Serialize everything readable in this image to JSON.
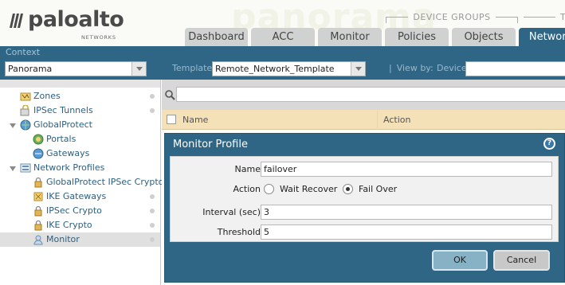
{
  "brand": {
    "name": "paloalto",
    "sub": "NETWORKS",
    "watermark": "panorama"
  },
  "header": {
    "group_label": "DEVICE GROUPS",
    "group_label_2": "T",
    "tabs": [
      {
        "label": "Dashboard",
        "active": false
      },
      {
        "label": "ACC",
        "active": false
      },
      {
        "label": "Monitor",
        "active": false
      },
      {
        "label": "Policies",
        "active": false
      },
      {
        "label": "Objects",
        "active": false
      },
      {
        "label": "Network",
        "active": true
      }
    ]
  },
  "context": {
    "label": "Context",
    "value": "Panorama",
    "template_label": "Template",
    "template_value": "Remote_Network_Template",
    "view_by_sep": "|",
    "view_by_label": "View by:",
    "device_label": "Device"
  },
  "sidebar": {
    "items": [
      {
        "label": "Zones",
        "icon": "zones-icon"
      },
      {
        "label": "IPSec Tunnels",
        "icon": "ipsec-tunnels-icon"
      },
      {
        "label": "GlobalProtect",
        "icon": "globalprotect-icon"
      },
      {
        "label": "Portals",
        "icon": "portals-icon"
      },
      {
        "label": "Gateways",
        "icon": "gateways-icon"
      },
      {
        "label": "Network Profiles",
        "icon": "network-profiles-icon"
      },
      {
        "label": "GlobalProtect IPSec Crypto",
        "icon": "lock-icon"
      },
      {
        "label": "IKE Gateways",
        "icon": "ike-gateways-icon"
      },
      {
        "label": "IPSec Crypto",
        "icon": "lock-icon"
      },
      {
        "label": "IKE Crypto",
        "icon": "lock-icon"
      },
      {
        "label": "Monitor",
        "icon": "monitor-profile-icon",
        "selected": true
      }
    ]
  },
  "grid": {
    "columns": [
      "Name",
      "Action"
    ]
  },
  "dialog": {
    "title": "Monitor Profile",
    "help": "?",
    "fields": {
      "name_label": "Name",
      "name_value": "failover",
      "action_label": "Action",
      "action_options": [
        {
          "label": "Wait Recover",
          "checked": false
        },
        {
          "label": "Fail Over",
          "checked": true
        }
      ],
      "interval_label": "Interval (sec)",
      "interval_value": "3",
      "threshold_label": "Threshold",
      "threshold_value": "5"
    },
    "ok_label": "OK",
    "cancel_label": "Cancel"
  },
  "colors": {
    "accent": "#2f6686",
    "tab_inactive": "#d0d2d2",
    "grid_header": "#f4e1b8",
    "sidebar_text": "#2d5f80",
    "brand_orange": "#f26f21"
  }
}
